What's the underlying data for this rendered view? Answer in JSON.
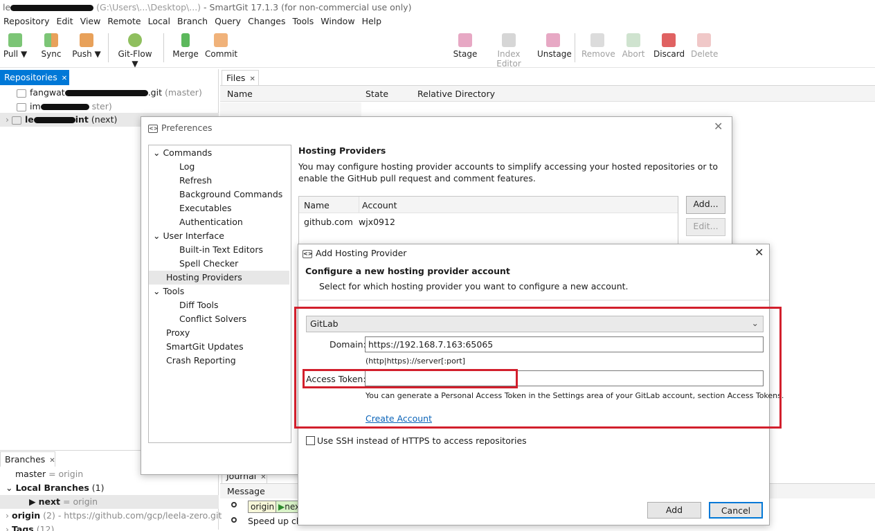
{
  "window": {
    "title_visible": "SmartGit 17.1.3 (for non-commercial use only)"
  },
  "menu": [
    "Repository",
    "Edit",
    "View",
    "Remote",
    "Local",
    "Branch",
    "Query",
    "Changes",
    "Tools",
    "Window",
    "Help"
  ],
  "toolbar": {
    "pull": "Pull ▼",
    "sync": "Sync",
    "push": "Push ▼",
    "gitflow": "Git-Flow ▼",
    "merge": "Merge",
    "commit": "Commit",
    "stage": "Stage",
    "index_editor": "Index Editor",
    "unstage": "Unstage",
    "remove": "Remove",
    "abort": "Abort",
    "discard": "Discard",
    "delete": "Delete"
  },
  "repos_panel": {
    "tab": "Repositories",
    "items": [
      {
        "name_visible": "fangwat",
        "suffix": ".git",
        "branch": "(master)"
      },
      {
        "name_visible": "im",
        "suffix": "",
        "branch": "ster)"
      },
      {
        "name_visible": "le",
        "suffix": "int",
        "branch": "(next)"
      }
    ]
  },
  "files_panel": {
    "tab": "Files",
    "columns": [
      "Name",
      "State",
      "Relative Directory"
    ]
  },
  "branches_panel": {
    "tab": "Branches",
    "rows": [
      {
        "name": "master",
        "detail": "= origin"
      },
      {
        "name": "Local Branches",
        "detail": "(1)"
      },
      {
        "name": "next",
        "detail": "= origin"
      },
      {
        "name": "origin",
        "detail": "(2) - https://github.com/gcp/leela-zero.git"
      },
      {
        "name": "Tags",
        "detail": "(12)"
      }
    ]
  },
  "journal_panel": {
    "tab": "Journal",
    "column": "Message",
    "tag1": "origin",
    "tag2": "nex",
    "row2": "Speed up ch"
  },
  "preferences": {
    "title": "Preferences",
    "tree": [
      "Commands",
      "Log",
      "Refresh",
      "Background Commands",
      "Executables",
      "Authentication",
      "User Interface",
      "Built-in Text Editors",
      "Spell Checker",
      "Hosting Providers",
      "Tools",
      "Diff Tools",
      "Conflict Solvers",
      "Proxy",
      "SmartGit Updates",
      "Crash Reporting"
    ],
    "section_title": "Hosting Providers",
    "description": "You may configure hosting provider accounts to simplify accessing your hosted repositories or to enable the GitHub pull request and comment features.",
    "table": {
      "columns": [
        "Name",
        "Account"
      ],
      "rows": [
        {
          "name": "github.com",
          "account": "wjx0912"
        }
      ]
    },
    "add_button": "Add...",
    "edit_button": "Edit..."
  },
  "add_dialog": {
    "title": "Add Hosting Provider",
    "heading": "Configure a new hosting provider account",
    "subheading": "Select for which hosting provider you want to configure a new account.",
    "provider_selected": "GitLab",
    "domain_label": "Domain:",
    "domain_value": "https://192.168.7.163:65065",
    "domain_hint": "(http|https)://server[:port]",
    "token_label": "Access Token:",
    "token_value": "",
    "token_hint": "You can generate a Personal Access Token in the Settings area of your GitLab account, section Access Tokens.",
    "create_account": "Create Account",
    "ssh_label": "Use SSH instead of HTTPS to access repositories",
    "add_button": "Add",
    "cancel_button": "Cancel"
  },
  "colors": {
    "accent": "#0078d7",
    "highlight_red": "#d21f2c",
    "link": "#0a63b8"
  }
}
